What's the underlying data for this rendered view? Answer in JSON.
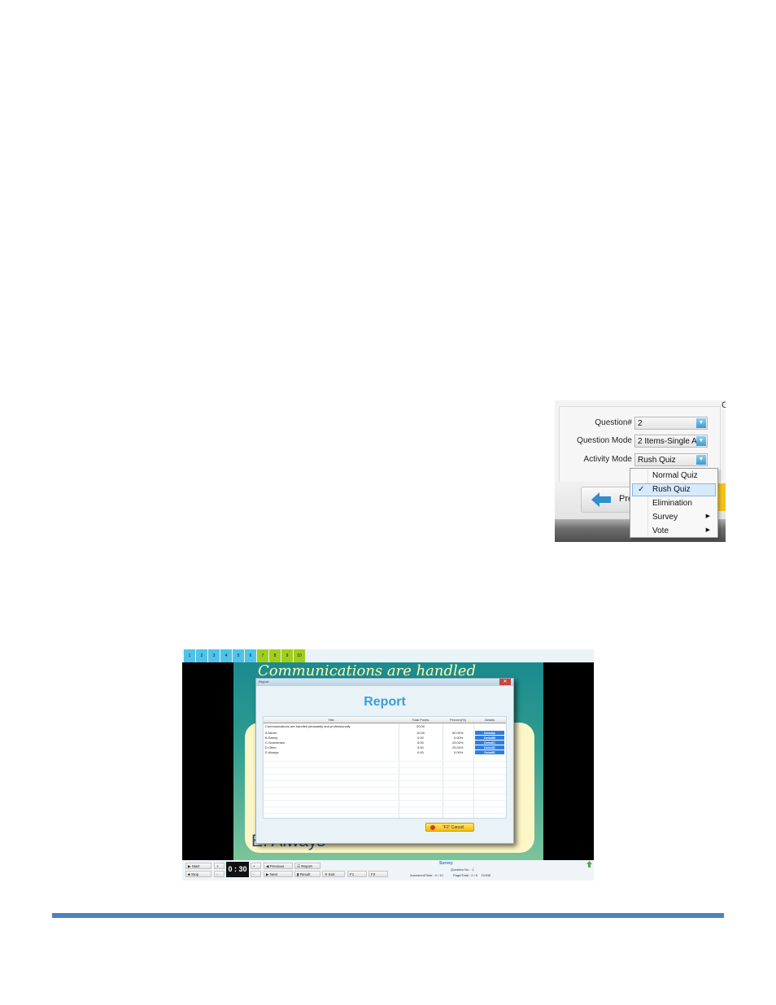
{
  "settings": {
    "corner_char": "C",
    "question_num_label": "Question#",
    "question_num_value": "2",
    "question_mode_label": "Question Mode",
    "question_mode_value": "2 Items-Single An",
    "activity_mode_label": "Activity Mode",
    "activity_mode_value": "Rush Quiz",
    "prev_button_label": "Pre"
  },
  "activity_menu": {
    "items": [
      {
        "label": "Normal Quiz",
        "checked": false,
        "submenu": false
      },
      {
        "label": "Rush Quiz",
        "checked": true,
        "submenu": false
      },
      {
        "label": "Elimination",
        "checked": false,
        "submenu": false
      },
      {
        "label": "Survey",
        "checked": false,
        "submenu": true
      },
      {
        "label": "Vote",
        "checked": false,
        "submenu": true
      }
    ]
  },
  "quiz": {
    "tabs": [
      "1",
      "2",
      "3",
      "4",
      "5",
      "6",
      "7",
      "8",
      "9",
      "10"
    ],
    "tab_colors": [
      "#4fc3e8",
      "#4fc3e8",
      "#4fc3e8",
      "#4fc3e8",
      "#4fc3e8",
      "#4fc3e8",
      "#9fcf1c",
      "#9fcf1c",
      "#9fcf1c",
      "#9fcf1c"
    ],
    "question_text": "Communications are handled",
    "option_e": "E.  Always",
    "report": {
      "window_title": "Report",
      "heading": "Report",
      "columns": [
        "Title",
        "Total Points",
        "Percent(%)",
        "Details"
      ],
      "question_row": {
        "title": "Communications are handled pleasantly and professionally.",
        "points": "20.00"
      },
      "rows": [
        {
          "title": "A.Never",
          "points": "10.00",
          "percent": "50.00%",
          "detail": "DetailA"
        },
        {
          "title": "B.Rarely",
          "points": "0.00",
          "percent": "0.00%",
          "detail": "DetailB"
        },
        {
          "title": "C.Sometimes",
          "points": "5.00",
          "percent": "25.00%",
          "detail": "DetailC"
        },
        {
          "title": "D.Often",
          "points": "5.00",
          "percent": "25.00%",
          "detail": "DetailD"
        },
        {
          "title": "E.Always",
          "points": "0.00",
          "percent": "0.00%",
          "detail": "DetailE"
        }
      ],
      "cancel_label": "\"F2\" Cancel"
    },
    "controls": {
      "start": "Start",
      "stop": "Stop",
      "plus": "+",
      "minus": "-",
      "timer": "0 : 30",
      "previous": "Previous",
      "report": "Report",
      "next": "Next",
      "result": "Result",
      "exit": "Exit",
      "f1": "F1",
      "f2": "F2",
      "mode": "Survey",
      "question_no": "Question No. : 1",
      "answered_total": "Answered/Total : 0 / 10",
      "page_total": "Page/Total : 2 / 8",
      "status": "DONE"
    }
  }
}
